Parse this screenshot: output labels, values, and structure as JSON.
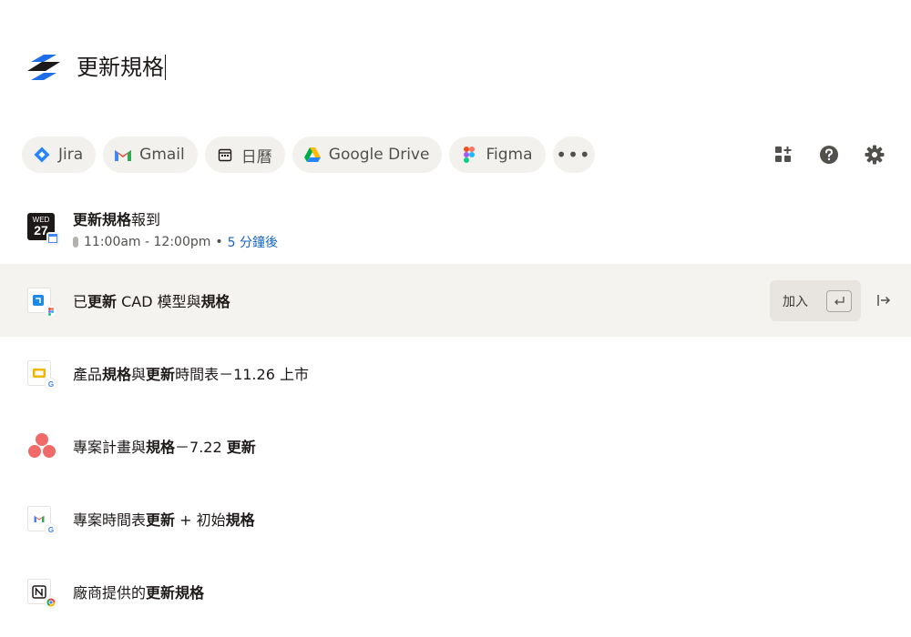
{
  "search": {
    "query": "更新規格"
  },
  "filters": [
    {
      "label": "Jira",
      "icon": "jira-icon"
    },
    {
      "label": "Gmail",
      "icon": "gmail-icon"
    },
    {
      "label": "日曆",
      "icon": "calendar-icon"
    },
    {
      "label": "Google Drive",
      "icon": "google-drive-icon"
    },
    {
      "label": "Figma",
      "icon": "figma-icon"
    },
    {
      "label": "•••",
      "icon": "more-icon"
    }
  ],
  "calendar_badge": {
    "weekday": "WED",
    "day": "27"
  },
  "results": [
    {
      "title_bold": "更新規格",
      "title_rest": "報到",
      "time": "11:00am - 12:00pm",
      "separator": "•",
      "relative": "5 分鐘後"
    },
    {
      "title_parts": [
        "已",
        "更新",
        " CAD 模型與",
        "規格"
      ],
      "action_label": "加入"
    },
    {
      "title_parts": [
        "產品",
        "規格",
        "與",
        "更新",
        "時間表－11.26 上市"
      ]
    },
    {
      "title_parts": [
        "專案計畫與",
        "規格",
        "－7.22 ",
        "更新"
      ]
    },
    {
      "title_parts": [
        "專案時間表",
        "更新",
        " + 初始",
        "規格"
      ]
    },
    {
      "title_parts": [
        "廠商提供的",
        "更新規格"
      ]
    }
  ],
  "colors": {
    "accent_blue": "#1564c0",
    "selected_row": "#f5f3ef",
    "chip_bg": "#f3f1ee"
  }
}
